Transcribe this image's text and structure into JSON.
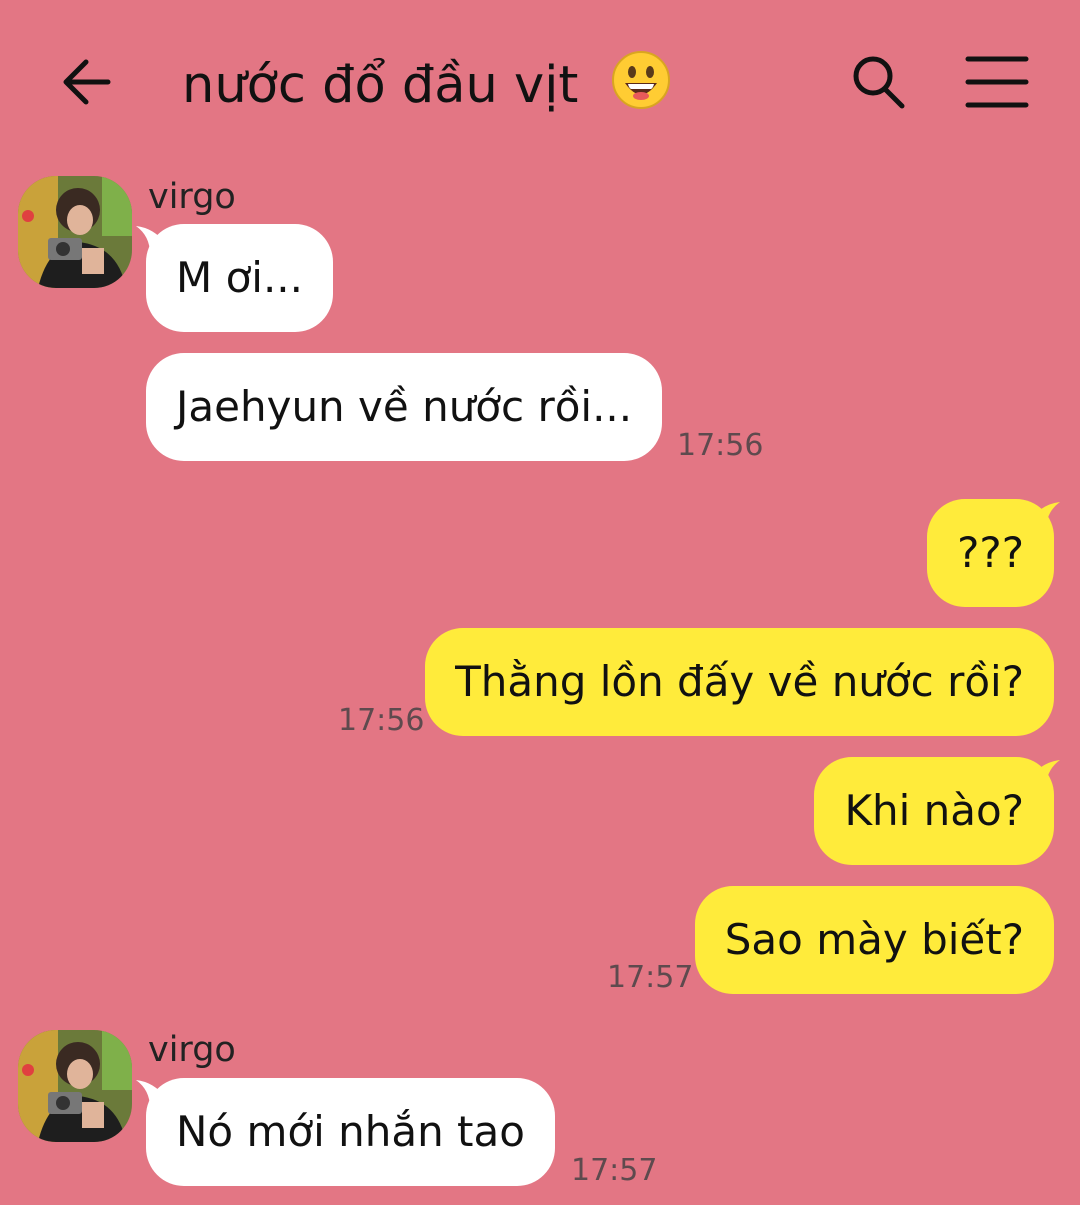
{
  "header": {
    "title": "nước đổ đầu vịt",
    "back_icon": "arrow-left-icon",
    "search_icon": "search-icon",
    "menu_icon": "hamburger-menu-icon",
    "title_emoji": "grinning-face-emoji"
  },
  "colors": {
    "background": "#e37684",
    "incoming_bubble": "#ffffff",
    "outgoing_bubble": "#ffeb3b"
  },
  "messages": {
    "group1": {
      "sender": "virgo",
      "m1": "M ơi...",
      "m2": "Jaehyun về nước rồi...",
      "time": "17:56"
    },
    "group2": {
      "m1": "???",
      "m2": "Thằng lồn đấy về nước rồi?",
      "time": "17:56"
    },
    "group3": {
      "m1": "Khi nào?",
      "m2": "Sao mày biết?",
      "time": "17:57"
    },
    "group4": {
      "sender": "virgo",
      "m1": "Nó mới nhắn tao",
      "time": "17:57"
    }
  }
}
